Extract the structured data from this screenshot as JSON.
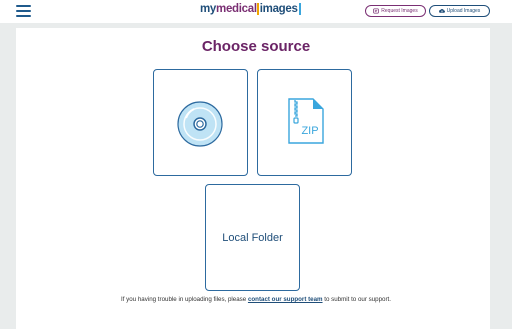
{
  "header": {
    "logo_part1": "my",
    "logo_part2": "medical",
    "logo_part3": "images",
    "request_button": "Request Images",
    "upload_button": "Upload Images"
  },
  "main": {
    "title": "Choose source",
    "tiles": {
      "cd": {
        "icon": "cd-icon"
      },
      "zip": {
        "icon": "zip-file-icon",
        "label": "ZIP"
      },
      "folder": {
        "label": "Local Folder"
      }
    },
    "help": {
      "prefix": "If you having trouble in uploading files, please ",
      "link": "contact our support team",
      "suffix": " to submit to our support."
    }
  },
  "colors": {
    "brand_purple": "#6b2466",
    "brand_blue": "#1f4e79",
    "tile_border": "#2d6a9f",
    "cd_fill": "#bfe3f5"
  }
}
